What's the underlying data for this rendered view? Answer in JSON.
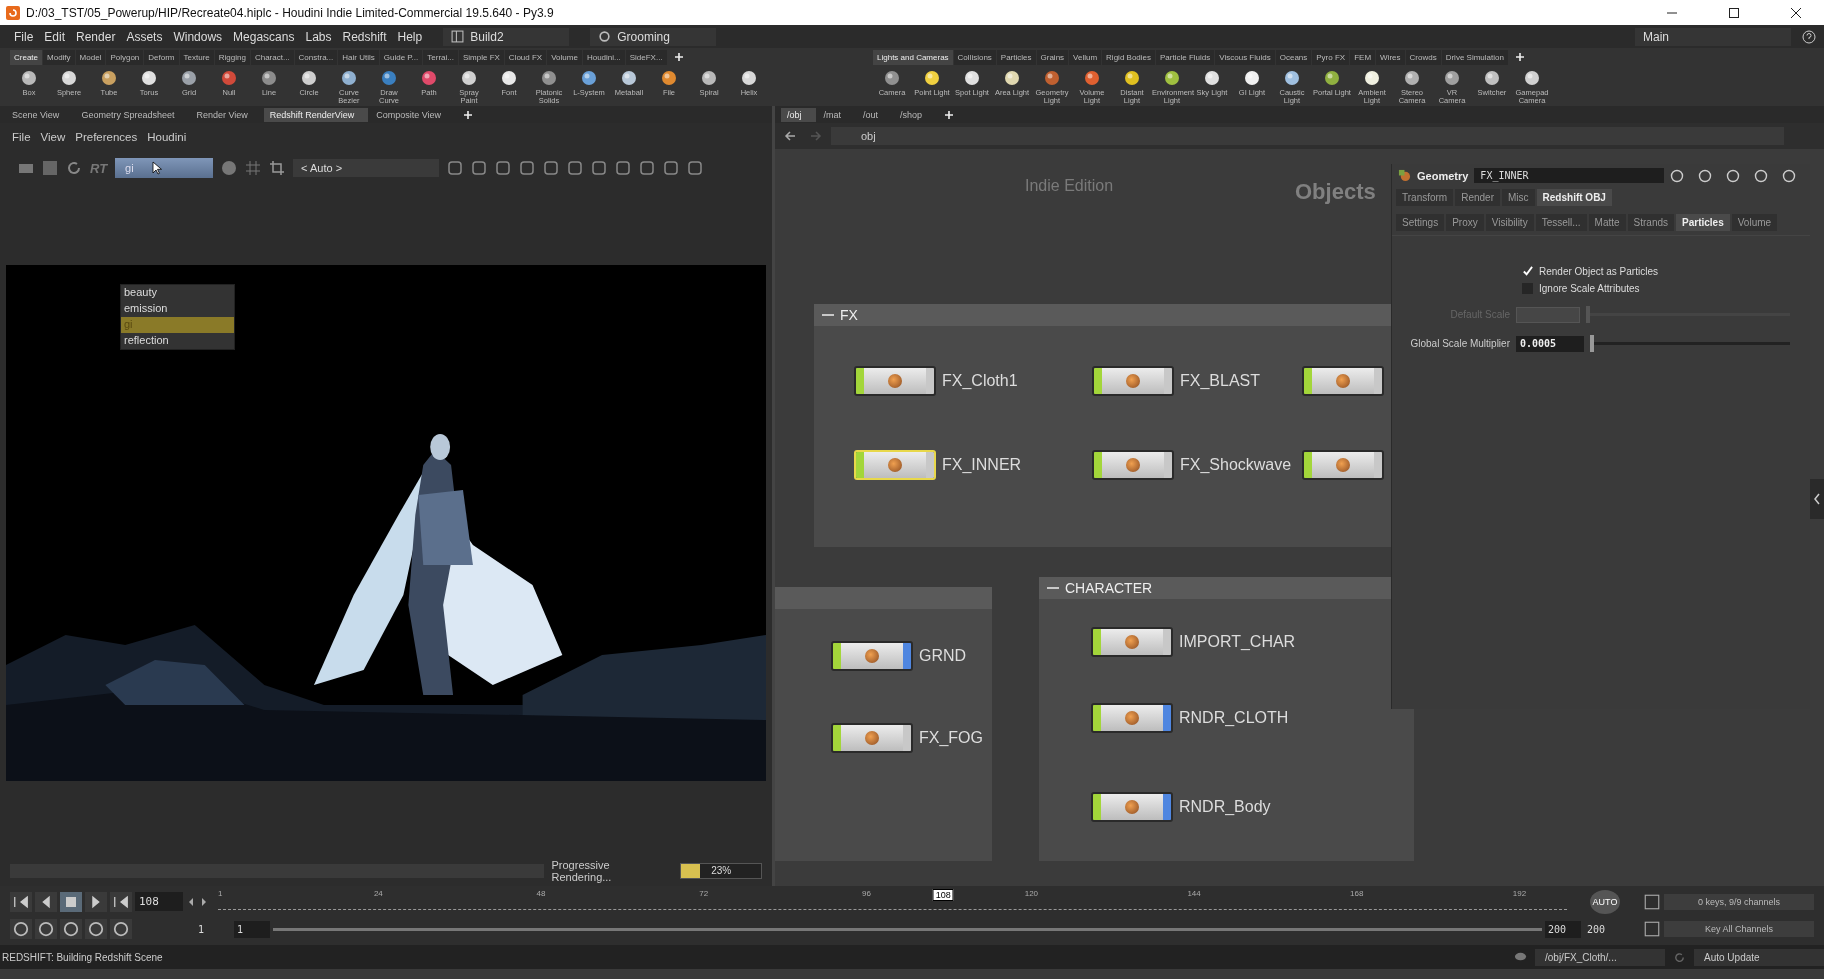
{
  "window": {
    "title": "D:/03_TST/05_Powerup/HIP/Recreate04.hiplc - Houdini Indie Limited-Commercial 19.5.640 - Py3.9"
  },
  "menu": [
    "File",
    "Edit",
    "Render",
    "Assets",
    "Windows",
    "Megascans",
    "Labs",
    "Redshift",
    "Help"
  ],
  "desktop": "Build2",
  "context": "Grooming",
  "pane_layout": "Main",
  "shelf_left": {
    "tabs": [
      {
        "label": "Create",
        "selected": true
      },
      {
        "label": "Modify",
        "selected": false
      },
      {
        "label": "Model",
        "selected": false
      },
      {
        "label": "Polygon",
        "selected": false
      },
      {
        "label": "Deform",
        "selected": false
      },
      {
        "label": "Texture",
        "selected": false
      },
      {
        "label": "Rigging",
        "selected": false
      },
      {
        "label": "Charact...",
        "selected": false
      },
      {
        "label": "Constra...",
        "selected": false
      },
      {
        "label": "Hair Utils",
        "selected": false
      },
      {
        "label": "Guide P...",
        "selected": false
      },
      {
        "label": "Terrai...",
        "selected": false
      },
      {
        "label": "Simple FX",
        "selected": false
      },
      {
        "label": "Cloud FX",
        "selected": false
      },
      {
        "label": "Volume",
        "selected": false
      },
      {
        "label": "Houdini...",
        "selected": false
      },
      {
        "label": "SideFX...",
        "selected": false
      }
    ],
    "tools": [
      "Box",
      "Sphere",
      "Tube",
      "Torus",
      "Grid",
      "Null",
      "Line",
      "Circle",
      "Curve Bezier",
      "Draw Curve",
      "Path",
      "Spray Paint",
      "Font",
      "Platonic Solids",
      "L-System",
      "Metaball",
      "File",
      "Spiral",
      "Helix"
    ]
  },
  "shelf_right": {
    "tabs": [
      {
        "label": "Lights and Cameras",
        "selected": true
      },
      {
        "label": "Collisions",
        "selected": false
      },
      {
        "label": "Particles",
        "selected": false
      },
      {
        "label": "Grains",
        "selected": false
      },
      {
        "label": "Vellum",
        "selected": false
      },
      {
        "label": "Rigid Bodies",
        "selected": false
      },
      {
        "label": "Particle Fluids",
        "selected": false
      },
      {
        "label": "Viscous Fluids",
        "selected": false
      },
      {
        "label": "Oceans",
        "selected": false
      },
      {
        "label": "Pyro FX",
        "selected": false
      },
      {
        "label": "FEM",
        "selected": false
      },
      {
        "label": "Wires",
        "selected": false
      },
      {
        "label": "Crowds",
        "selected": false
      },
      {
        "label": "Drive Simulation",
        "selected": false
      }
    ],
    "tools": [
      "Camera",
      "Point Light",
      "Spot Light",
      "Area Light",
      "Geometry Light",
      "Volume Light",
      "Distant Light",
      "Environment Light",
      "Sky Light",
      "GI Light",
      "Caustic Light",
      "Portal Light",
      "Ambient Light",
      "Stereo Camera",
      "VR Camera",
      "Switcher",
      "Gamepad Camera"
    ]
  },
  "left_pane": {
    "tabs": [
      {
        "label": "Scene View",
        "selected": false
      },
      {
        "label": "Geometry Spreadsheet",
        "selected": false
      },
      {
        "label": "Render View",
        "selected": false
      },
      {
        "label": "Redshift RenderView",
        "selected": true
      },
      {
        "label": "Composite View",
        "selected": false
      }
    ],
    "menu": [
      "File",
      "View",
      "Preferences",
      "Houdini"
    ],
    "rt_label": "RT",
    "aov_field": "gi",
    "aov_options": [
      {
        "label": "beauty",
        "selected": false
      },
      {
        "label": "emission",
        "selected": false
      },
      {
        "label": "gi",
        "selected": true
      },
      {
        "label": "reflection",
        "selected": false
      }
    ],
    "camera_field": "< Auto >",
    "progress": {
      "label": "Progressive Rendering...",
      "level": 0.23,
      "reading": "23%"
    }
  },
  "network": {
    "tabs": [
      {
        "label": "/obj",
        "selected": true
      },
      {
        "label": "/mat",
        "selected": false
      },
      {
        "label": "/out",
        "selected": false
      },
      {
        "label": "/shop",
        "selected": false
      }
    ],
    "path": "obj",
    "edition": "Indie Edition",
    "context_label": "Objects",
    "boxes": [
      {
        "title": "FX",
        "nodes": [
          {
            "name": "FX_Cloth1",
            "selected": false,
            "color": "#c8c8c8"
          },
          {
            "name": "FX_BLAST",
            "selected": false,
            "color": "#c8c8c8"
          },
          {
            "selected": false,
            "color": "#c8c8c8"
          },
          {
            "name": "FX_INNER",
            "selected": true,
            "color": "#c8c8c8"
          },
          {
            "name": "FX_Shockwave",
            "selected": false,
            "color": "#c8c8c8"
          },
          {
            "selected": false,
            "color": "#c8c8c8"
          }
        ]
      },
      {
        "nodes": [
          {
            "name": "GRND",
            "selected": false,
            "color": "#4f86e0"
          },
          {
            "name": "FX_FOG",
            "selected": false,
            "color": "#c8c8c8"
          }
        ]
      },
      {
        "title": "CHARACTER",
        "nodes": [
          {
            "name": "IMPORT_CHAR",
            "selected": false,
            "color": "#c8c8c8"
          },
          {
            "name": "RNDR_CLOTH",
            "selected": false,
            "color": "#4f86e0"
          },
          {
            "name": "RNDR_Body",
            "selected": false,
            "color": "#4f86e0"
          }
        ]
      }
    ]
  },
  "parameters": {
    "type": "Geometry",
    "name": "FX_INNER",
    "tabs": [
      {
        "label": "Transform",
        "selected": false
      },
      {
        "label": "Render",
        "selected": false
      },
      {
        "label": "Misc",
        "selected": false
      },
      {
        "label": "Redshift OBJ",
        "selected": true
      }
    ],
    "subtabs": [
      {
        "label": "Settings",
        "selected": false
      },
      {
        "label": "Proxy",
        "selected": false
      },
      {
        "label": "Visibility",
        "selected": false
      },
      {
        "label": "Tessell...",
        "selected": false
      },
      {
        "label": "Matte",
        "selected": false
      },
      {
        "label": "Strands",
        "selected": false
      },
      {
        "label": "Particles",
        "selected": true
      },
      {
        "label": "Volume",
        "selected": false
      }
    ],
    "toggles": [
      {
        "label": "Render Object as Particles",
        "checked": true
      },
      {
        "label": "Ignore Scale Attributes",
        "checked": false
      }
    ],
    "sliders": [
      {
        "label": "Default Scale",
        "disabled": true,
        "level": 0
      },
      {
        "label": "Global Scale Multiplier",
        "value": "0.0005",
        "disabled": false,
        "level": 0
      }
    ]
  },
  "timeline": {
    "frame": "108",
    "ticks": [
      "1",
      "24",
      "48",
      "72",
      "96",
      "120",
      "144",
      "168",
      "192"
    ],
    "marker": "108",
    "start": "1",
    "range_start": "1",
    "range_end": "200",
    "end": "200",
    "auto_label": "AUTO",
    "keys": "0 keys, 9/9 channels",
    "key_mode": "Key All Channels"
  },
  "status": {
    "message": "REDSHIFT: Building Redshift Scene",
    "path": "/obj/FX_Cloth/...",
    "update_mode": "Auto Update"
  }
}
